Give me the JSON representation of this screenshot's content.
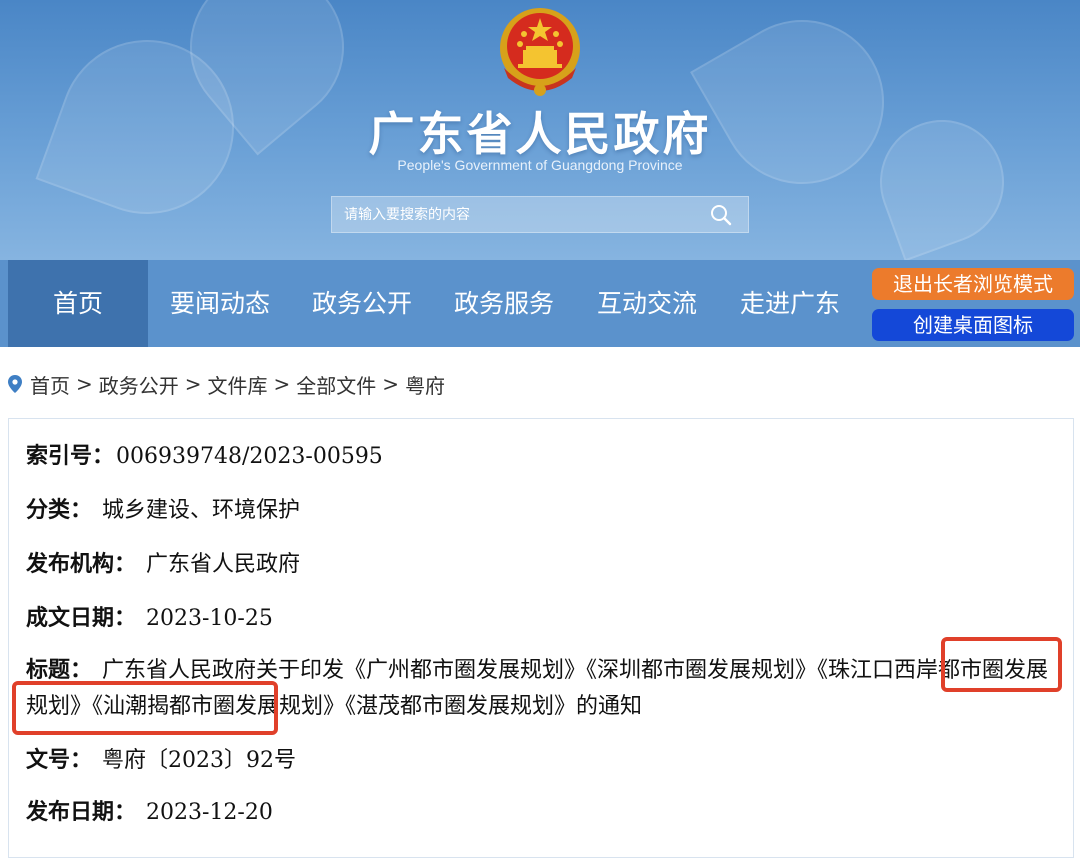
{
  "header": {
    "title": "广东省人民政府",
    "subtitle": "People's Government of Guangdong Province",
    "search_placeholder": "请输入要搜索的内容"
  },
  "nav": {
    "items": [
      {
        "label": "首页",
        "active": true
      },
      {
        "label": "要闻动态"
      },
      {
        "label": "政务公开"
      },
      {
        "label": "政务服务"
      },
      {
        "label": "互动交流"
      },
      {
        "label": "走进广东"
      }
    ],
    "exit_elder_mode": "退出长者浏览模式",
    "create_desktop_icon": "创建桌面图标"
  },
  "breadcrumb": [
    "首页",
    "政务公开",
    "文件库",
    "全部文件",
    "粤府"
  ],
  "breadcrumb_separator": ">",
  "info": {
    "index_label": "索引号：",
    "index_value": "006939748/2023-00595",
    "category_label": "分类：",
    "category_value": "城乡建设、环境保护",
    "issuer_label": "发布机构：",
    "issuer_value": "广东省人民政府",
    "written_date_label": "成文日期：",
    "written_date_value": "2023-10-25",
    "title_label": "标题：",
    "title_value": "广东省人民政府关于印发《广州都市圈发展规划》《深圳都市圈发展规划》《珠江口西岸都市圈发展规划》《汕潮揭都市圈发展规划》《湛茂都市圈发展规划》的通知",
    "doc_no_label": "文号：",
    "doc_no_value": "粤府〔2023〕92号",
    "publish_date_label": "发布日期：",
    "publish_date_value": "2023-12-20"
  },
  "colors": {
    "header_blue": "#4a86c6",
    "nav_blue": "#5b92cc",
    "nav_active": "#3e72ad",
    "exit_button": "#ec7b2c",
    "desktop_button": "#1448d8",
    "highlight_red": "#e0402a"
  },
  "icons": {
    "emblem": "national-emblem-icon",
    "search": "search-icon",
    "location": "location-pin-icon"
  }
}
